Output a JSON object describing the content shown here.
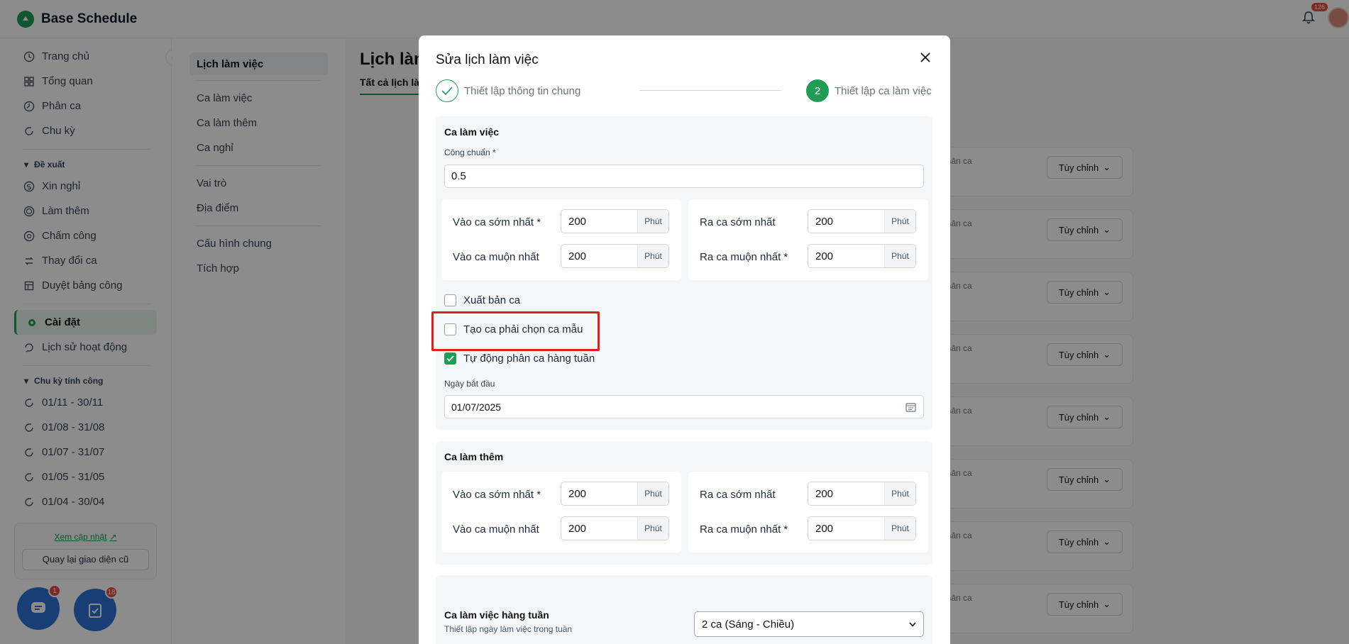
{
  "app": {
    "name": "Base Schedule",
    "notification_count": "126",
    "brand_color": "#1f9d55"
  },
  "sidebar": {
    "items": [
      {
        "label": "Trang chủ",
        "icon": "clock-icon"
      },
      {
        "label": "Tổng quan",
        "icon": "grid-icon"
      },
      {
        "label": "Phân ca",
        "icon": "clock-icon"
      },
      {
        "label": "Chu kỳ",
        "icon": "refresh-icon"
      }
    ],
    "group_proposals": "Đề xuất",
    "proposals": [
      {
        "label": "Xin nghỉ",
        "icon": "dollar-icon"
      },
      {
        "label": "Làm thêm",
        "icon": "target-icon"
      },
      {
        "label": "Chấm công",
        "icon": "at-icon"
      },
      {
        "label": "Thay đổi ca",
        "icon": "swap-icon"
      },
      {
        "label": "Duyệt bảng công",
        "icon": "table-icon"
      }
    ],
    "settings": "Cài đặt",
    "history": "Lịch sử hoạt động",
    "group_cycles": "Chu kỳ tính công",
    "cycles": [
      "01/11 - 30/11",
      "01/08 - 31/08",
      "01/07 - 31/07",
      "01/05 - 31/05",
      "01/04 - 30/04"
    ],
    "update_link": "Xem cập nhật",
    "old_ui_button": "Quay lại giao diện cũ",
    "chat_badge": "1",
    "task_badge": "18"
  },
  "subnav": {
    "items": [
      "Lịch làm việc",
      "Ca làm việc",
      "Ca làm thêm",
      "Ca nghỉ",
      "Vai trò",
      "Địa điểm",
      "Cấu hình chung",
      "Tích hợp"
    ]
  },
  "main": {
    "title": "Lịch làm",
    "tab": "Tất cả lịch là",
    "rows": [
      {
        "label": "phân ca",
        "button": "Tùy chỉnh"
      },
      {
        "label": "phân ca",
        "button": "Tùy chỉnh"
      },
      {
        "label": "phân ca",
        "button": "Tùy chỉnh"
      },
      {
        "label": "phân ca",
        "button": "Tùy chỉnh"
      },
      {
        "label": "phân ca",
        "button": "Tùy chỉnh"
      },
      {
        "label": "phân ca",
        "button": "Tùy chỉnh"
      },
      {
        "label": "phân ca",
        "button": "Tùy chỉnh"
      },
      {
        "label": "phân ca",
        "button": "Tùy chỉnh"
      }
    ]
  },
  "modal": {
    "title": "Sửa lịch làm việc",
    "steps": [
      {
        "number": "",
        "label": "Thiết lập thông tin chung",
        "state": "done"
      },
      {
        "number": "2",
        "label": "Thiết lập ca làm việc",
        "state": "active"
      }
    ],
    "work_shift": {
      "title": "Ca làm việc",
      "standard_label": "Công chuẩn *",
      "standard_value": "0.5",
      "left": [
        {
          "label": "Vào ca sớm nhất *",
          "value": "200",
          "unit": "Phút"
        },
        {
          "label": "Vào ca muộn nhất",
          "value": "200",
          "unit": "Phút"
        }
      ],
      "right": [
        {
          "label": "Ra ca sớm nhất",
          "value": "200",
          "unit": "Phút"
        },
        {
          "label": "Ra ca muộn nhất *",
          "value": "200",
          "unit": "Phút"
        }
      ],
      "checkboxes": [
        {
          "label": "Xuất bản ca",
          "checked": false
        },
        {
          "label": "Tạo ca phải chọn ca mẫu",
          "checked": false
        },
        {
          "label": "Tự động phân ca hàng tuần",
          "checked": true
        }
      ],
      "start_date_label": "Ngày bắt đầu",
      "start_date_value": "01/07/2025"
    },
    "overtime": {
      "title": "Ca làm thêm",
      "left": [
        {
          "label": "Vào ca sớm nhất *",
          "value": "200",
          "unit": "Phút"
        },
        {
          "label": "Vào ca muộn nhất",
          "value": "200",
          "unit": "Phút"
        }
      ],
      "right": [
        {
          "label": "Ra ca sớm nhất",
          "value": "200",
          "unit": "Phút"
        },
        {
          "label": "Ra ca muộn nhất *",
          "value": "200",
          "unit": "Phút"
        }
      ]
    },
    "weekly": {
      "title": "Ca làm việc hàng tuần",
      "subtitle": "Thiết lập ngày làm việc trong tuần",
      "select_value": "2 ca (Sáng - Chiều)"
    },
    "highlight_color": "#e11d24"
  }
}
